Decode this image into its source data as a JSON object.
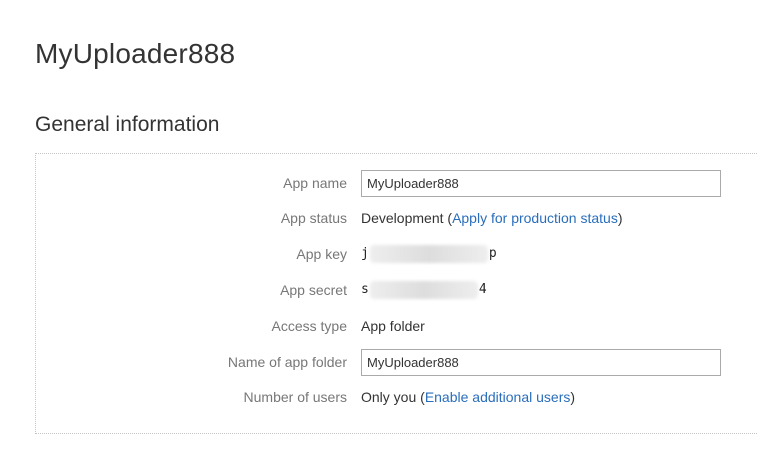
{
  "page": {
    "title": "MyUploader888"
  },
  "general_information": {
    "heading": "General information",
    "app_name": {
      "label": "App name",
      "value": "MyUploader888"
    },
    "app_status": {
      "label": "App status",
      "value": "Development",
      "open_paren": " (",
      "link_label": "Apply for production status",
      "close_paren": ")"
    },
    "app_key": {
      "label": "App key",
      "visible_start": "j",
      "visible_end": "p"
    },
    "app_secret": {
      "label": "App secret",
      "visible_start": "s",
      "visible_end": "4"
    },
    "access_type": {
      "label": "Access type",
      "value": "App folder"
    },
    "app_folder": {
      "label": "Name of app folder",
      "value": "MyUploader888"
    },
    "number_of_users": {
      "label": "Number of users",
      "value": "Only you",
      "open_paren": " (",
      "link_label": "Enable additional users",
      "close_paren": ")"
    }
  },
  "colors": {
    "link": "#2a6ebb",
    "label": "#777777",
    "text": "#333333"
  }
}
